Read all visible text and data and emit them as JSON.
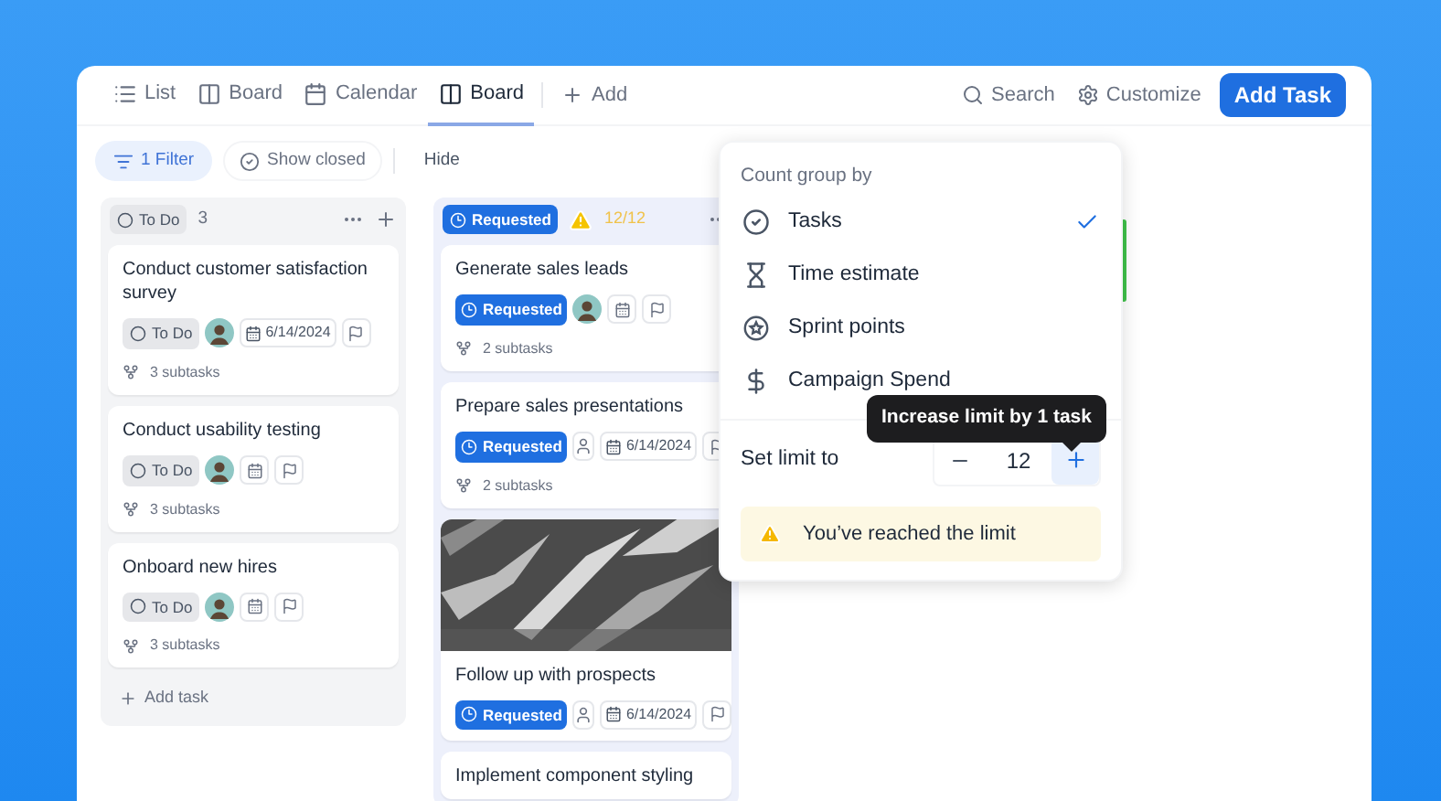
{
  "tabs": [
    {
      "kind": "list",
      "label": "List",
      "selected": false
    },
    {
      "kind": "board",
      "label": "Board",
      "selected": false
    },
    {
      "kind": "calendar",
      "label": "Calendar",
      "selected": false
    },
    {
      "kind": "board",
      "label": "Board",
      "selected": true
    }
  ],
  "add_view": "Add",
  "search": "Search",
  "customize": "Customize",
  "add_task_button": "Add Task",
  "filter": "1 Filter",
  "show_closed": "Show closed",
  "hide": "Hide",
  "columns": [
    {
      "kind": "todo",
      "status": "To Do",
      "count": "3",
      "add_task": "Add task",
      "cards": [
        {
          "title": "Conduct customer satisfaction survey",
          "status": "To Do",
          "assigned": true,
          "date": "6/14/2024",
          "subtasks": "3 subtasks"
        },
        {
          "title": "Conduct usability testing",
          "status": "To Do",
          "assigned": true,
          "subtasks": "3 subtasks"
        },
        {
          "title": "Onboard new hires",
          "status": "To Do",
          "assigned": true,
          "subtasks": "3 subtasks"
        }
      ]
    },
    {
      "kind": "requested",
      "status": "Requested",
      "warning": "12/12",
      "cards": [
        {
          "title": "Generate sales leads",
          "status": "Requested",
          "assigned": true,
          "subtasks": "2 subtasks"
        },
        {
          "title": "Prepare sales presentations",
          "status": "Requested",
          "assigned": false,
          "date": "6/14/2024",
          "subtasks": "2 subtasks"
        },
        {
          "title": "Follow up with prospects",
          "status": "Requested",
          "assigned": false,
          "date": "6/14/2024"
        },
        {
          "title": "Implement component styling"
        }
      ]
    }
  ],
  "popup": {
    "heading": "Count group by",
    "options": [
      {
        "kind": "tasks",
        "label": "Tasks",
        "selected": true
      },
      {
        "kind": "time",
        "label": "Time estimate",
        "selected": false
      },
      {
        "kind": "points",
        "label": "Sprint points",
        "selected": false
      },
      {
        "kind": "money",
        "label": "Campaign Spend",
        "selected": false
      }
    ],
    "limit_label": "Set limit to",
    "limit_value": "12",
    "tooltip": "Increase limit by 1 task",
    "warning": "You’ve reached the limit"
  }
}
